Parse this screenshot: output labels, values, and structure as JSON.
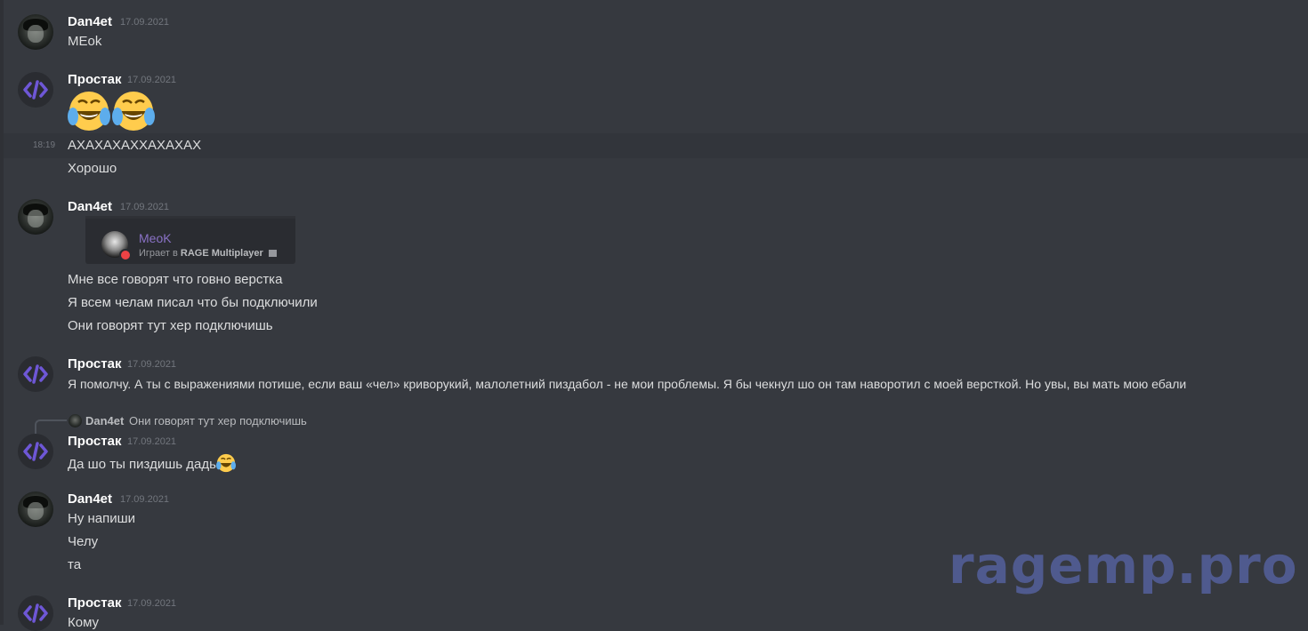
{
  "messages": [
    {
      "author": "Dan4et",
      "timestamp": "17.09.2021",
      "lines": [
        "MEok"
      ]
    },
    {
      "author": "Простак",
      "timestamp": "17.09.2021",
      "emoji": "joy-emoji x2"
    },
    {
      "side_time": "18:19",
      "lines": [
        "АХАХАХАХХАХАХАХ",
        "Хорошо"
      ]
    },
    {
      "author": "Dan4et",
      "timestamp": "17.09.2021",
      "embed": {
        "name": "MeoK",
        "status_prefix": "Играет в",
        "status_game": "RAGE Multiplayer"
      },
      "lines": [
        "Мне все говорят что говно верстка",
        "Я всем челам писал что бы подключили",
        "Они говорят тут хер подключишь"
      ]
    },
    {
      "author": "Простак",
      "timestamp": "17.09.2021",
      "lines": [
        "Я помолчу. А ты с выражениями потише, если ваш «чел» криворукий, малолетний пиздабол - не мои проблемы. Я бы чекнул шо он там наворотил с моей версткой. Но увы, вы мать мою ебали"
      ]
    },
    {
      "reply": {
        "author": "Dan4et",
        "text": "Они говорят тут хер подключишь"
      },
      "author": "Простак",
      "timestamp": "17.09.2021",
      "lines": [
        "Да шо ты пиздишь дадь"
      ]
    },
    {
      "author": "Dan4et",
      "timestamp": "17.09.2021",
      "lines": [
        "Ну напиши",
        "Челу",
        "та"
      ]
    },
    {
      "author": "Простак",
      "timestamp": "17.09.2021",
      "lines": [
        "Кому"
      ]
    }
  ],
  "watermark": "ragemp.pro"
}
